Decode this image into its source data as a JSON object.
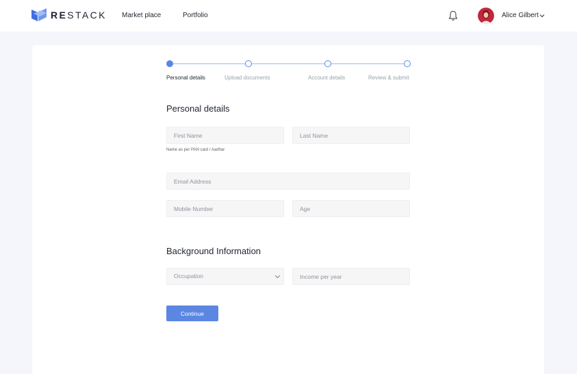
{
  "brand": {
    "name_bold": "RE",
    "name_rest": "STACK",
    "logo_icon": "stacked-layers-logo",
    "accent_color": "#5b87e3"
  },
  "nav": {
    "links": [
      "Market place",
      "Portfolio"
    ],
    "notification_icon": "bell-icon",
    "user_name": "Alice Gilbert",
    "user_menu_icon": "chevron-down-icon"
  },
  "stepper": {
    "steps": [
      "Personal details",
      "Upload documents",
      "Account details",
      "Review & submit"
    ],
    "active_index": 0
  },
  "personal": {
    "title": "Personal details",
    "first_name_placeholder": "First Name",
    "last_name_placeholder": "Last Name",
    "helper": "Name as per PAN card / Aadhar",
    "email_placeholder": "Email Address",
    "mobile_placeholder": "Mobile Number",
    "age_placeholder": "Age"
  },
  "background": {
    "title": "Background Information",
    "occupation_placeholder": "Occupation",
    "income_placeholder": "Income per year"
  },
  "actions": {
    "continue_label": "Continue"
  }
}
